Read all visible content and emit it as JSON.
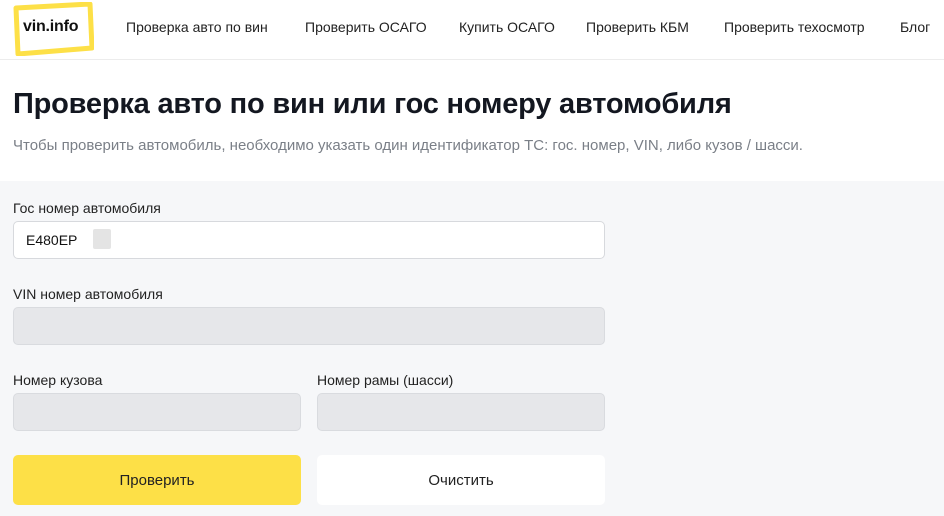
{
  "header": {
    "logo_text": "vin.info",
    "nav": [
      "Проверка авто по вин",
      "Проверить ОСАГО",
      "Купить ОСАГО",
      "Проверить КБМ",
      "Проверить техосмотр",
      "Блог"
    ]
  },
  "page": {
    "title": "Проверка авто по вин или гос номеру автомобиля",
    "subtitle": "Чтобы проверить автомобиль, необходимо указать один идентификатор ТС: гос. номер, VIN, либо кузов / шасси."
  },
  "form": {
    "plate": {
      "label": "Гос номер автомобиля",
      "value": "Е480ЕР"
    },
    "vin": {
      "label": "VIN номер автомобиля",
      "value": ""
    },
    "body": {
      "label": "Номер кузова",
      "value": ""
    },
    "frame": {
      "label": "Номер рамы (шасси)",
      "value": ""
    },
    "submit_label": "Проверить",
    "clear_label": "Очистить"
  },
  "colors": {
    "accent": "#fde047",
    "form_background": "#f6f7f9",
    "disabled_field": "#e6e7ea"
  }
}
